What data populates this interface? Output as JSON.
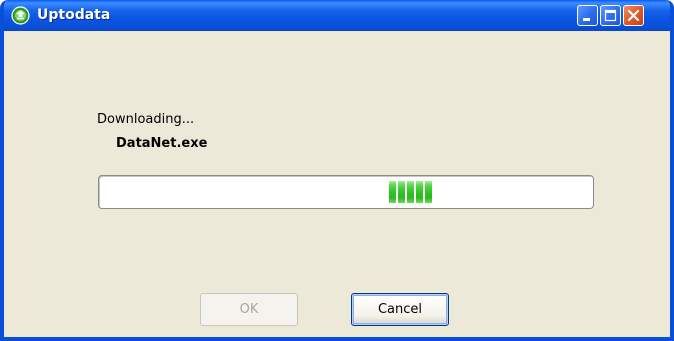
{
  "window": {
    "title": "Uptodata",
    "icon": "app-globe-icon",
    "accent_color": "#0a4fd8",
    "caption_buttons": [
      "minimize-icon",
      "maximize-icon",
      "close-icon"
    ]
  },
  "dialog": {
    "status_label": "Downloading...",
    "file_name": "DataNet.exe",
    "progress": {
      "style": "marquee",
      "active_blocks": 5,
      "block_color": "#30c424"
    }
  },
  "buttons": {
    "ok_label": "OK",
    "ok_enabled": false,
    "cancel_label": "Cancel"
  }
}
